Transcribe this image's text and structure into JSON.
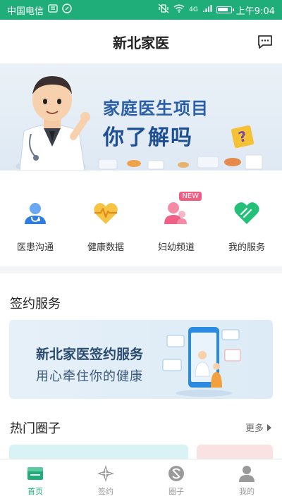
{
  "status": {
    "carrier": "中国电信",
    "network": "4G",
    "time": "上午9:04",
    "battery_level": 0.85
  },
  "header": {
    "title": "新北家医",
    "message_icon": "chat-bubble-icon"
  },
  "banner": {
    "line1": "家庭医生项目",
    "line2": "你了解吗",
    "question_mark": "?"
  },
  "quick_menu": [
    {
      "label": "医患沟通",
      "icon": "doctor-icon",
      "color": "#2f7de1"
    },
    {
      "label": "健康数据",
      "icon": "heartbeat-icon",
      "color": "#f2b52a"
    },
    {
      "label": "妇幼频道",
      "icon": "mother-child-icon",
      "color": "#ef5f86",
      "badge": "NEW"
    },
    {
      "label": "我的服务",
      "icon": "heart-service-icon",
      "color": "#23c07a"
    }
  ],
  "sign_section": {
    "title": "签约服务",
    "card_title": "新北家医签约服务",
    "card_subtitle": "用心牵住你的健康"
  },
  "hot_section": {
    "title": "热门圈子",
    "more": "更多"
  },
  "bottom_nav": [
    {
      "label": "首页",
      "icon": "home-icon",
      "active": true
    },
    {
      "label": "签约",
      "icon": "sign-icon",
      "active": false
    },
    {
      "label": "圈子",
      "icon": "circle-icon",
      "active": false
    },
    {
      "label": "我的",
      "icon": "profile-icon",
      "active": false
    }
  ],
  "colors": {
    "brand": "#1fae7a",
    "banner_text": "#1e4f92",
    "nav_inactive": "#9a9a9a"
  }
}
